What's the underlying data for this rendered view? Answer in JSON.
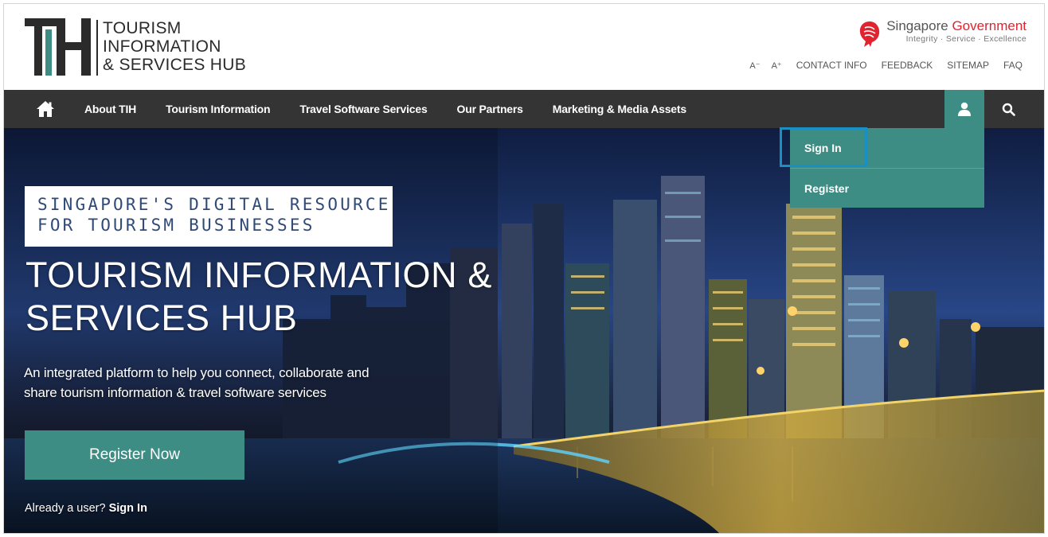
{
  "header": {
    "logo": {
      "mark": "TIH",
      "lines": [
        "TOURISM",
        "INFORMATION",
        "& SERVICES HUB"
      ]
    },
    "gov": {
      "name_part1": "Singapore",
      "name_part2": "Government",
      "tagline": "Integrity · Service · Excellence"
    },
    "utility": {
      "font_decrease": "A⁻",
      "font_increase": "A⁺",
      "links": [
        "CONTACT INFO",
        "FEEDBACK",
        "SITEMAP",
        "FAQ"
      ]
    }
  },
  "nav": {
    "home_icon": "home-icon",
    "items": [
      "About TIH",
      "Tourism Information",
      "Travel Software Services",
      "Our Partners",
      "Marketing & Media Assets"
    ],
    "user_icon": "user-icon",
    "search_icon": "search-icon"
  },
  "dropdown": {
    "items": [
      "Sign In",
      "Register"
    ]
  },
  "hero": {
    "eyebrow_lines": [
      "SINGAPORE'S DIGITAL RESOURCE",
      "FOR TOURISM BUSINESSES"
    ],
    "title_lines": [
      "TOURISM INFORMATION &",
      "SERVICES HUB"
    ],
    "subtitle_lines": [
      "An integrated platform to help you connect, collaborate and",
      "share tourism information & travel software services"
    ],
    "cta": "Register Now",
    "already_prefix": "Already a user?",
    "already_link": "Sign In"
  },
  "colors": {
    "accent": "#3d8d85",
    "nav_bg": "#343434",
    "highlight": "#1a8fc4",
    "gov_red": "#e0232f",
    "eyebrow_text": "#2f4a78"
  }
}
